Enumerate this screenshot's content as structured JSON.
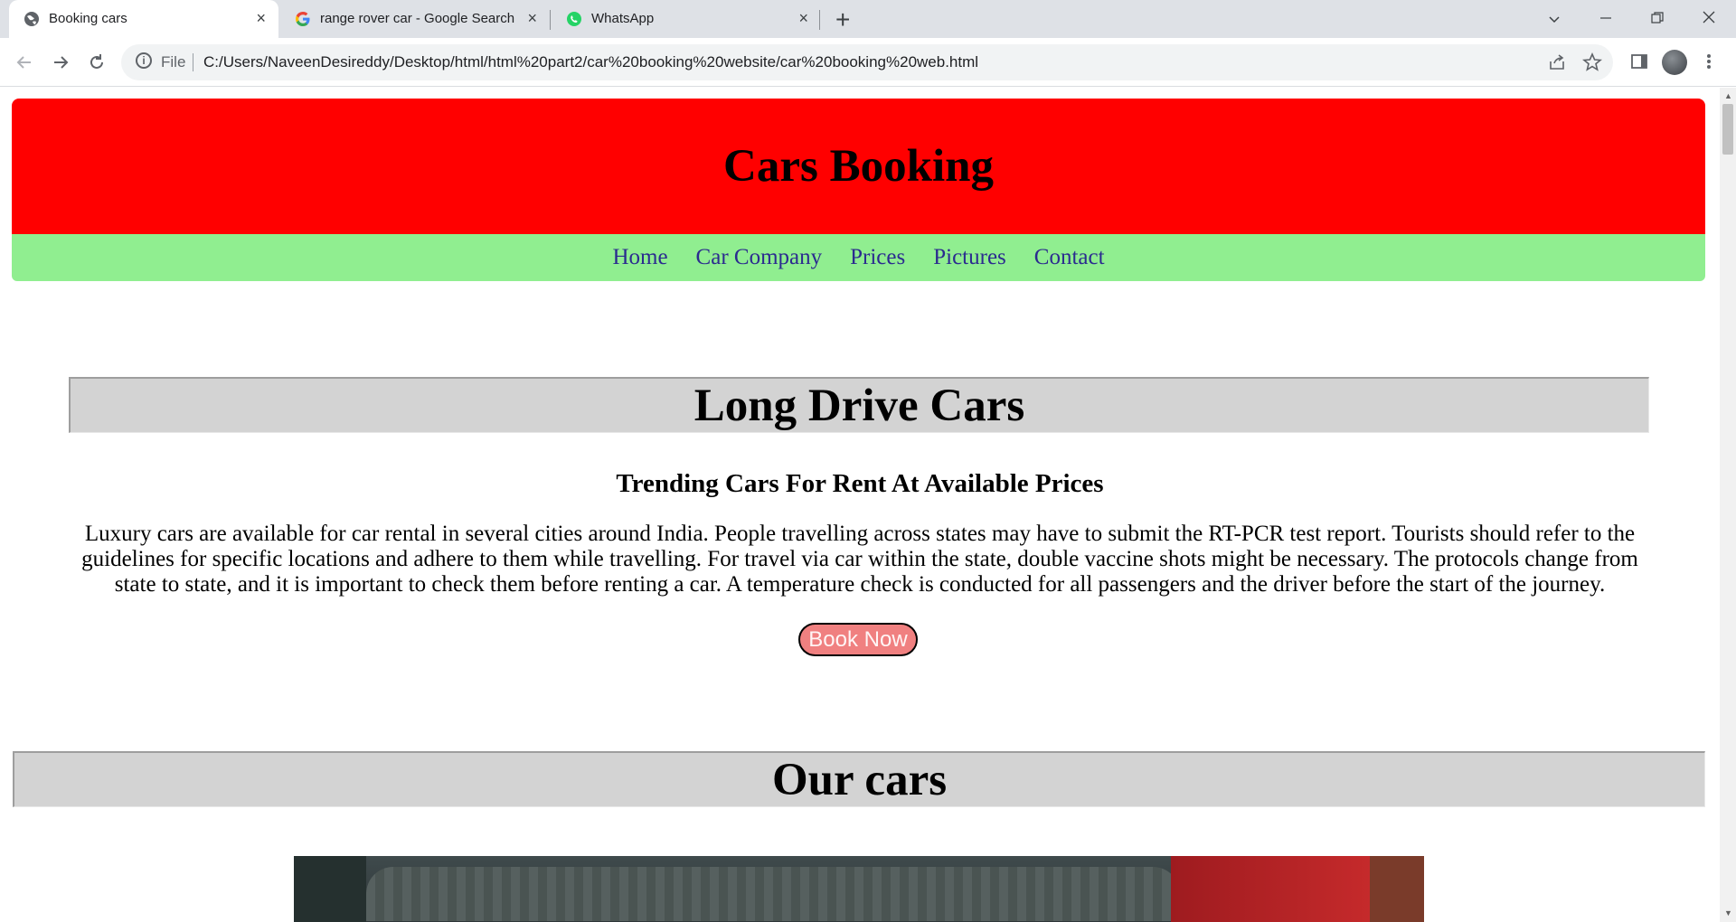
{
  "browser": {
    "tabs": [
      {
        "title": "Booking cars",
        "icon": "globe-icon",
        "active": true
      },
      {
        "title": "range rover car - Google Search",
        "icon": "google-icon",
        "active": false
      },
      {
        "title": "WhatsApp",
        "icon": "whatsapp-icon",
        "active": false
      }
    ],
    "close_glyph": "×",
    "new_tab_glyph": "+",
    "address": {
      "scheme_label": "File",
      "url": "C:/Users/NaveenDesireddy/Desktop/html/html%20part2/car%20booking%20website/car%20booking%20web.html"
    }
  },
  "page": {
    "header_title": "Cars Booking",
    "nav": [
      "Home",
      "Car Company",
      "Prices",
      "Pictures",
      "Contact"
    ],
    "section1_title": "Long Drive Cars",
    "subheading": "Trending Cars For Rent At Available Prices",
    "paragraph": "Luxury cars are available for car rental in several cities around India. People travelling across states may have to submit the RT-PCR test report. Tourists should refer to the guidelines for specific locations and adhere to them while travelling. For travel via car within the state, double vaccine shots might be necessary. The protocols change from state to state, and it is important to check them before renting a car. A temperature check is conducted for all passengers and the driver before the start of the journey.",
    "book_button": "Book Now",
    "section2_title": "Our cars"
  },
  "colors": {
    "header_bg": "#ff0000",
    "nav_bg": "#90ee90",
    "nav_link": "#2b2b8f",
    "section_bg": "#d3d3d3",
    "button_bg": "#f08080"
  }
}
